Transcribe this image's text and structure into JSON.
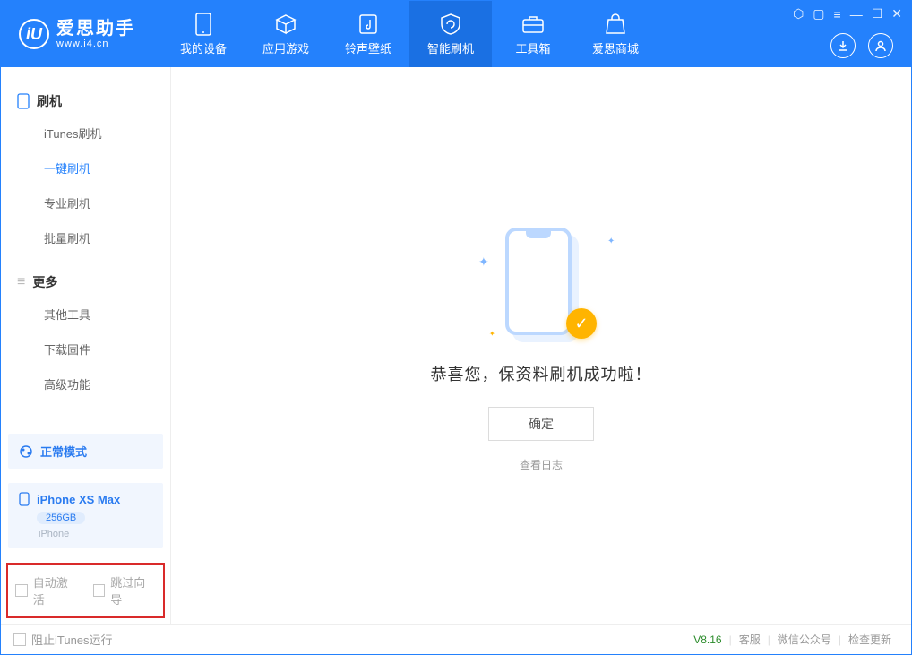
{
  "app": {
    "title": "爱思助手",
    "subtitle": "www.i4.cn"
  },
  "header": {
    "tabs": [
      {
        "label": "我的设备"
      },
      {
        "label": "应用游戏"
      },
      {
        "label": "铃声壁纸"
      },
      {
        "label": "智能刷机"
      },
      {
        "label": "工具箱"
      },
      {
        "label": "爱思商城"
      }
    ]
  },
  "sidebar": {
    "section1": {
      "title": "刷机"
    },
    "items1": [
      {
        "label": "iTunes刷机"
      },
      {
        "label": "一键刷机"
      },
      {
        "label": "专业刷机"
      },
      {
        "label": "批量刷机"
      }
    ],
    "section2": {
      "title": "更多"
    },
    "items2": [
      {
        "label": "其他工具"
      },
      {
        "label": "下载固件"
      },
      {
        "label": "高级功能"
      }
    ],
    "mode": {
      "label": "正常模式"
    },
    "device": {
      "name": "iPhone XS Max",
      "capacity": "256GB",
      "type": "iPhone"
    },
    "options": {
      "auto_activate": "自动激活",
      "skip_guide": "跳过向导"
    }
  },
  "main": {
    "success_msg": "恭喜您，保资料刷机成功啦！",
    "ok_btn": "确定",
    "log_link": "查看日志"
  },
  "footer": {
    "block_itunes": "阻止iTunes运行",
    "version": "V8.16",
    "links": {
      "support": "客服",
      "wechat": "微信公众号",
      "update": "检查更新"
    }
  }
}
